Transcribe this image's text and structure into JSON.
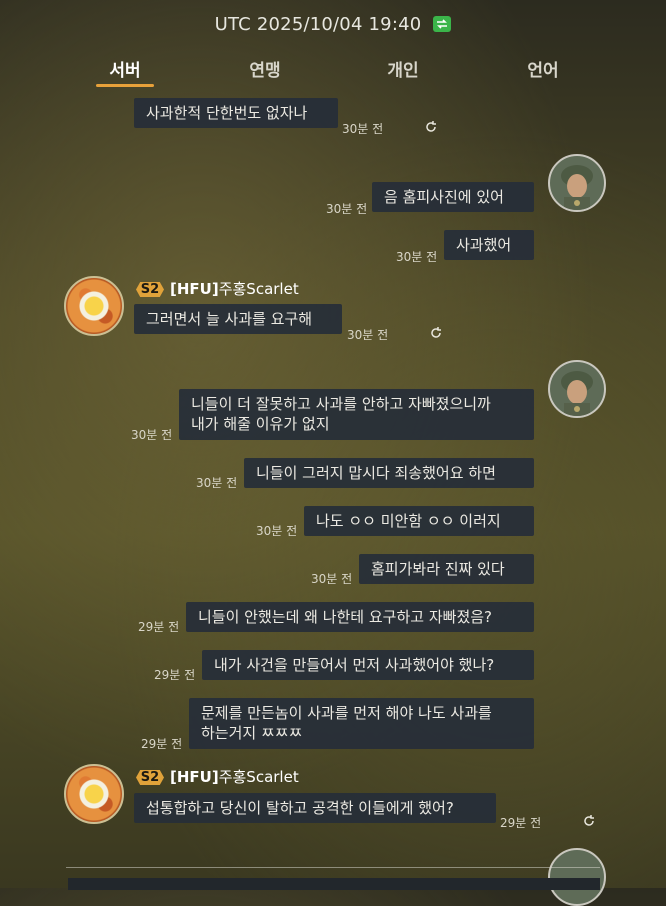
{
  "header": {
    "time": "UTC 2025/10/04 19:40"
  },
  "tabs": [
    {
      "label": "서버",
      "active": true
    },
    {
      "label": "연맹",
      "active": false
    },
    {
      "label": "개인",
      "active": false
    },
    {
      "label": "언어",
      "active": false
    }
  ],
  "sender": {
    "rank": "S2",
    "alliance": "[HFU]",
    "name": "주홍Scarlet"
  },
  "messages": [
    {
      "text": "사과한적 단한번도 없자나",
      "time": "30분 전"
    },
    {
      "text": "음 홈피사진에 있어",
      "time": "30분 전"
    },
    {
      "text": "사과했어",
      "time": "30분 전"
    },
    {
      "text": "그러면서 늘 사과를 요구해",
      "time": "30분 전"
    },
    {
      "text": "니들이 더 잘못하고 사과를 안하고 자빠졌으니까\n내가 해줄 이유가 없지",
      "time": "30분 전"
    },
    {
      "text": "니들이 그러지 맙시다 죄송했어요 하면",
      "time": "30분 전"
    },
    {
      "text": "나도 ㅇㅇ 미안함 ㅇㅇ 이러지",
      "time": "30분 전"
    },
    {
      "text": "홈피가봐라 진짜 있다",
      "time": "30분 전"
    },
    {
      "text": "니들이 안했는데 왜 나한테 요구하고 자빠졌음?",
      "time": "29분 전"
    },
    {
      "text": "내가 사건을 만들어서 먼저 사과했어야 했나?",
      "time": "29분 전"
    },
    {
      "text": "문제를 만든놈이 사과를 먼저 해야 나도 사과를\n하는거지 ㅉㅉㅉ",
      "time": "29분 전"
    },
    {
      "text": "섭통합하고 당신이 탈하고 공격한 이들에게 했어?",
      "time": "29분 전"
    }
  ]
}
